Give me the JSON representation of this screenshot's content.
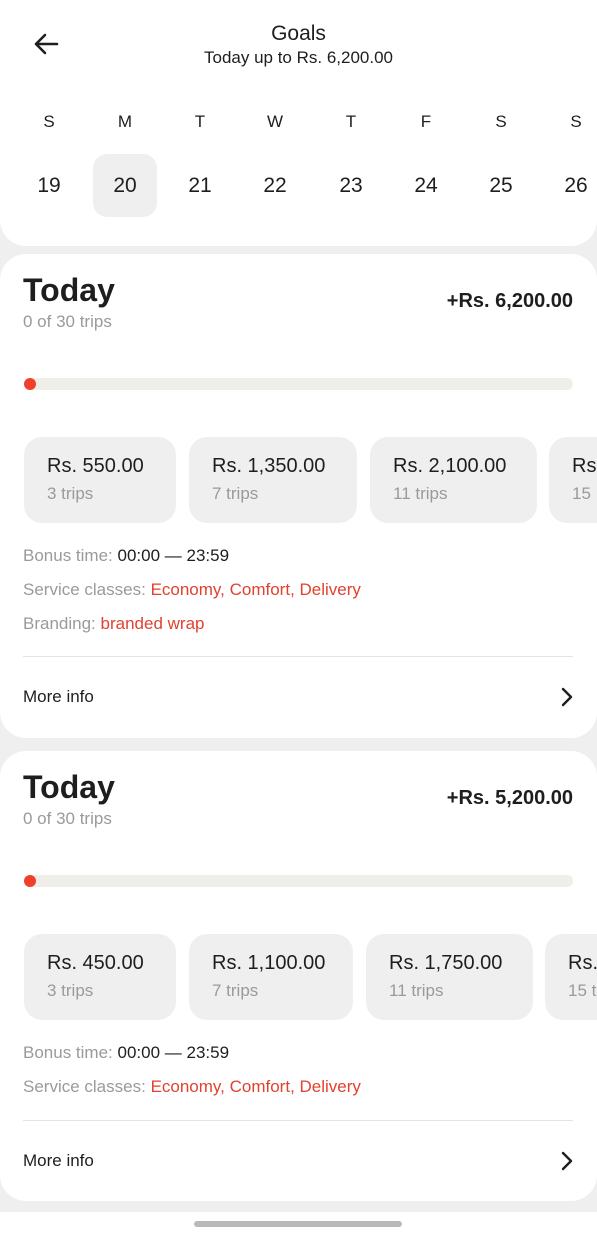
{
  "header": {
    "title": "Goals",
    "subtitle": "Today up to Rs. 6,200.00"
  },
  "week": {
    "days": [
      {
        "name": "S",
        "num": "19",
        "selected": false
      },
      {
        "name": "M",
        "num": "20",
        "selected": true
      },
      {
        "name": "T",
        "num": "21",
        "selected": false
      },
      {
        "name": "W",
        "num": "22",
        "selected": false
      },
      {
        "name": "T",
        "num": "23",
        "selected": false
      },
      {
        "name": "F",
        "num": "24",
        "selected": false
      },
      {
        "name": "S",
        "num": "25",
        "selected": false
      },
      {
        "name": "S",
        "num": "26",
        "selected": false
      }
    ]
  },
  "goals": [
    {
      "title": "Today",
      "trips": "0 of 30 trips",
      "amount": "+Rs. 6,200.00",
      "progress": 0,
      "tiers": [
        {
          "amount": "Rs. 550.00",
          "trips": "3 trips"
        },
        {
          "amount": "Rs. 1,350.00",
          "trips": "7 trips"
        },
        {
          "amount": "Rs. 2,100.00",
          "trips": "11 trips"
        },
        {
          "amount": "Rs",
          "trips": "15"
        }
      ],
      "bonus_label": "Bonus time:",
      "bonus_value": "00:00 — 23:59",
      "service_label": "Service classes:",
      "service_value": "Economy, Comfort, Delivery",
      "branding_label": "Branding:",
      "branding_value": "branded wrap",
      "more_info": "More info"
    },
    {
      "title": "Today",
      "trips": "0 of 30 trips",
      "amount": "+Rs. 5,200.00",
      "progress": 0,
      "tiers": [
        {
          "amount": "Rs. 450.00",
          "trips": "3 trips"
        },
        {
          "amount": "Rs. 1,100.00",
          "trips": "7 trips"
        },
        {
          "amount": "Rs. 1,750.00",
          "trips": "11 trips"
        },
        {
          "amount": "Rs.",
          "trips": "15 t"
        }
      ],
      "bonus_label": "Bonus time:",
      "bonus_value": "00:00 — 23:59",
      "service_label": "Service classes:",
      "service_value": "Economy, Comfort, Delivery",
      "more_info": "More info"
    }
  ],
  "colors": {
    "accent": "#f0402b",
    "link_red": "#e2412f",
    "muted": "#9a9a9a",
    "background": "#efefef"
  },
  "icons": {
    "back": "arrow-left-icon",
    "chevron": "chevron-right-icon"
  }
}
